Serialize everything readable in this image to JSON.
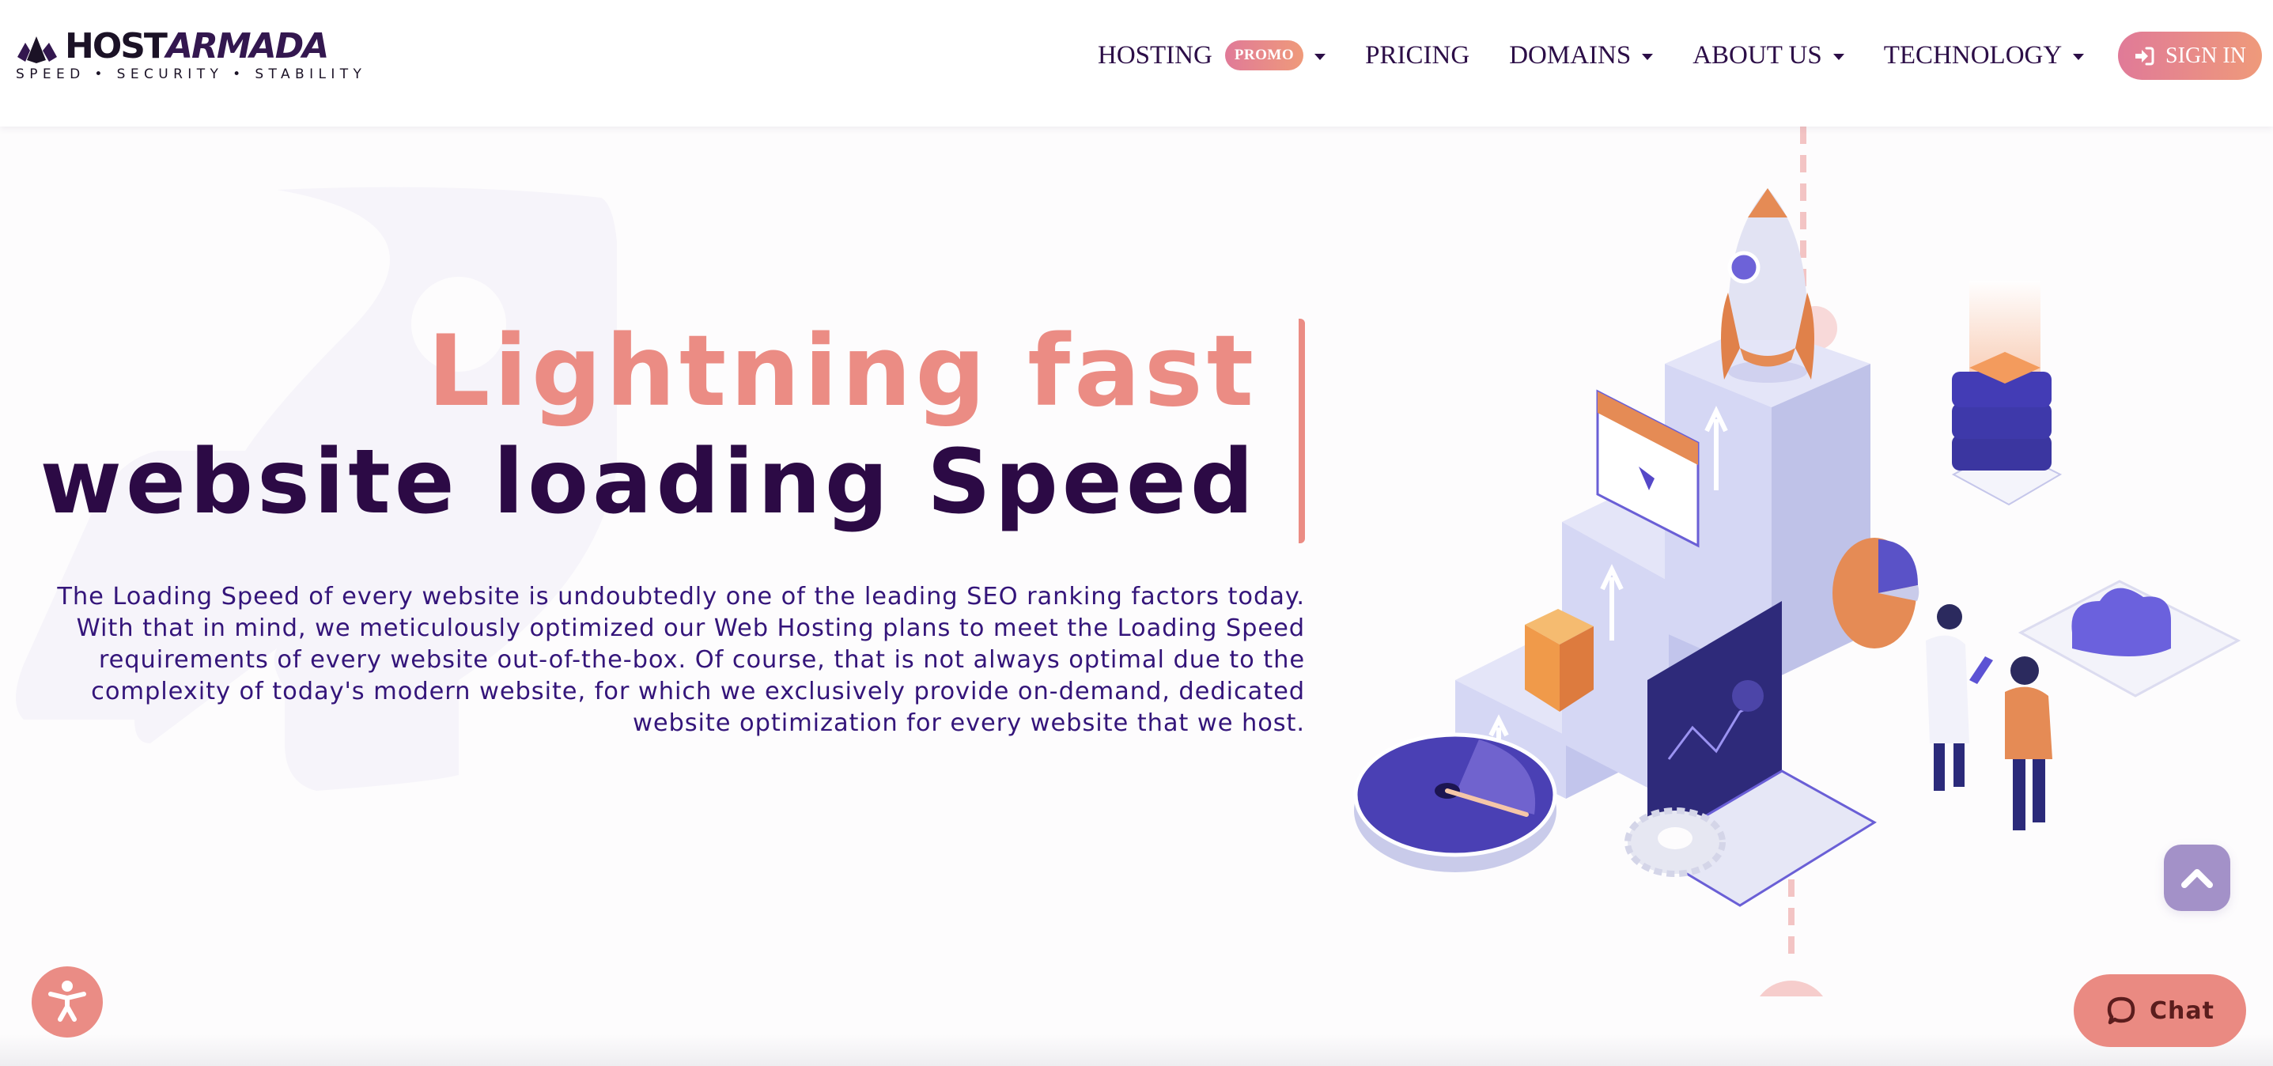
{
  "brand": {
    "name_part1": "HOST",
    "name_part2": "ARMADA",
    "tagline": "SPEED • SECURITY • STABILITY",
    "colors": {
      "dark": "#1b1226",
      "purple": "#33174f",
      "accent": "#eb8c84",
      "nav_text": "#2c0e47"
    }
  },
  "nav": {
    "items": [
      {
        "label": "HOSTING",
        "badge": "PROMO",
        "has_dropdown": true
      },
      {
        "label": "PRICING",
        "has_dropdown": false
      },
      {
        "label": "DOMAINS",
        "has_dropdown": true
      },
      {
        "label": "ABOUT US",
        "has_dropdown": true
      },
      {
        "label": "TECHNOLOGY",
        "has_dropdown": true
      }
    ],
    "signin_label": "SIGN IN",
    "signin_icon": "sign-in-icon"
  },
  "hero": {
    "headline_line1": "Lightning fast",
    "headline_line2": "website loading Speed",
    "description": "The Loading Speed of every website is undoubtedly one of the leading SEO ranking factors today. With that in mind, we meticulously optimized our Web Hosting plans to meet the Loading Speed requirements of every website out-of-the-box. Of course, that is not always optimal due to the complexity of today's modern website, for which we exclusively provide on-demand, dedicated website optimization for every website that we host.",
    "illustration": "isometric-speed-illustration"
  },
  "floating": {
    "accessibility_icon": "accessibility-icon",
    "scroll_top_icon": "chevron-up-icon",
    "chat_label": "Chat",
    "chat_icon": "chat-bubble-icon"
  }
}
